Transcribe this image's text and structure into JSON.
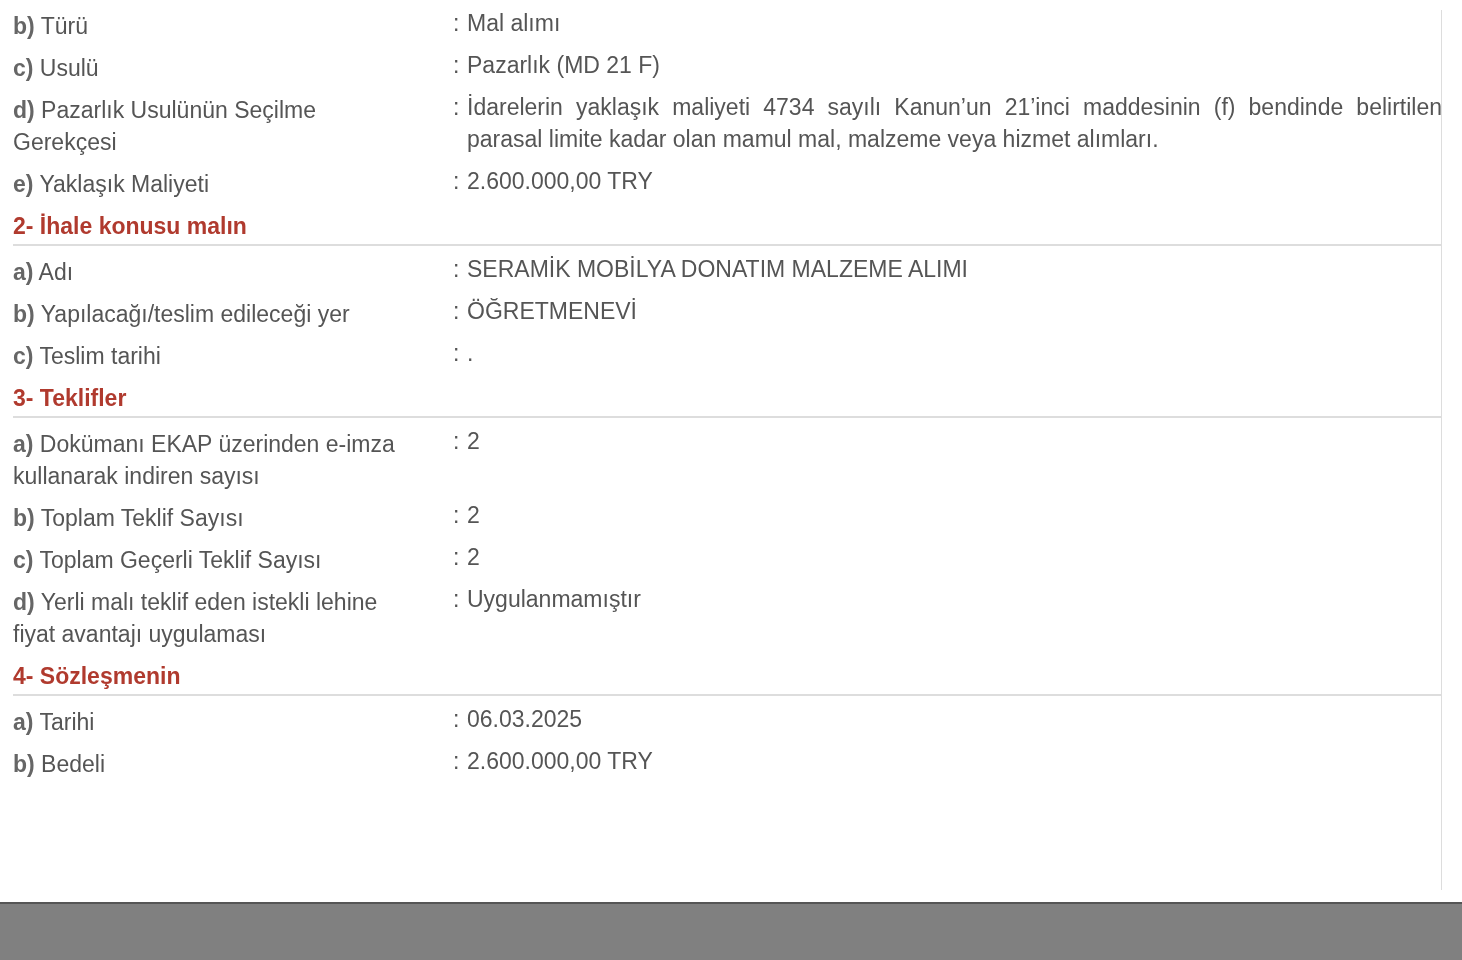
{
  "sections": [
    {
      "rows": [
        {
          "letter": "b)",
          "label": "Türü",
          "sep": ":",
          "value": "Mal alımı"
        },
        {
          "letter": "c)",
          "label": "Usulü",
          "sep": ":",
          "value": "Pazarlık (MD 21 F)"
        },
        {
          "letter": "d)",
          "label": "Pazarlık Usulünün Seçilme Gerekçesi",
          "sep": ":",
          "value": "İdarelerin yaklaşık maliyeti 4734 sayılı Kanun’un 21’inci maddesinin (f) bendinde belirtilen parasal limite kadar olan mamul mal, malzeme veya hizmet alımları."
        },
        {
          "letter": "e)",
          "label": "Yaklaşık Maliyeti",
          "sep": ":",
          "value": "2.600.000,00 TRY"
        }
      ]
    },
    {
      "title": "2- İhale konusu malın",
      "rows": [
        {
          "letter": "a)",
          "label": "Adı",
          "sep": ":",
          "value": "SERAMİK MOBİLYA DONATIM MALZEME ALIMI"
        },
        {
          "letter": "b)",
          "label": "Yapılacağı/teslim edileceği yer",
          "sep": ":",
          "value": "ÖĞRETMENEVİ"
        },
        {
          "letter": "c)",
          "label": "Teslim tarihi",
          "sep": ":",
          "value": "."
        }
      ]
    },
    {
      "title": "3- Teklifler",
      "rows": [
        {
          "letter": "a)",
          "label": "Dokümanı EKAP üzerinden e-imza kullanarak indiren sayısı",
          "sep": ":",
          "value": "2"
        },
        {
          "letter": "b)",
          "label": "Toplam Teklif Sayısı",
          "sep": ":",
          "value": "2"
        },
        {
          "letter": "c)",
          "label": "Toplam Geçerli Teklif Sayısı",
          "sep": ":",
          "value": "2"
        },
        {
          "letter": "d)",
          "label": "Yerli malı teklif eden istekli lehine fiyat avantajı uygulaması",
          "sep": ":",
          "value": "Uygulanmamıştır"
        }
      ]
    },
    {
      "title": "4- Sözleşmenin",
      "rows": [
        {
          "letter": "a)",
          "label": "Tarihi",
          "sep": ":",
          "value": "06.03.2025"
        },
        {
          "letter": "b)",
          "label": "Bedeli",
          "sep": ":",
          "value": "2.600.000,00 TRY"
        }
      ]
    }
  ]
}
